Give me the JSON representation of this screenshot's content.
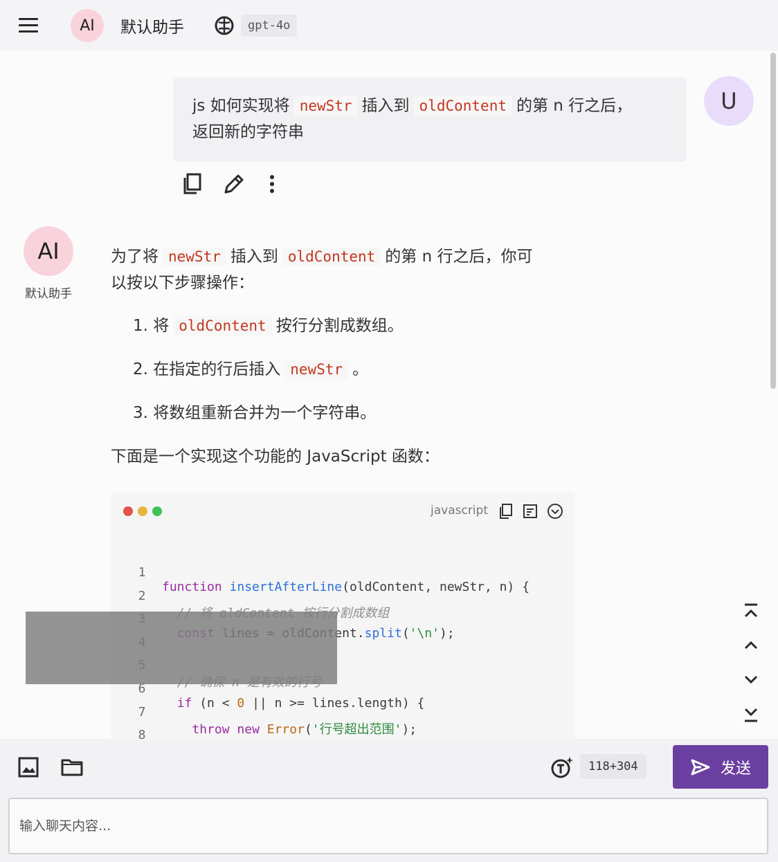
{
  "header": {
    "avatar_text": "AI",
    "assistant_name": "默认助手",
    "model": "gpt-4o"
  },
  "user_message": {
    "avatar": "U",
    "text_1": "js 如何实现将",
    "code_1": "newStr",
    "text_2": "插入到",
    "code_2": "oldContent",
    "text_3": "的第 n 行之后，",
    "text_4": "返回新的字符串",
    "actions": [
      "copy-icon",
      "edit-icon",
      "more-vert-icon"
    ]
  },
  "assistant": {
    "avatar": "AI",
    "name": "默认助手",
    "intro_1": "为了将",
    "intro_code_1": "newStr",
    "intro_2": "插入到",
    "intro_code_2": "oldContent",
    "intro_3": "的第 n 行之后，你可",
    "intro_4": "以按以下步骤操作：",
    "steps": [
      {
        "pre": "1. 将",
        "code": "oldContent",
        "post": "按行分割成数组。"
      },
      {
        "pre": "2. 在指定的行后插入",
        "code": "newStr",
        "post": "。"
      },
      {
        "pre": "3. 将数组重新合并为一个字符串。",
        "code": "",
        "post": ""
      }
    ],
    "outro": "下面是一个实现这个功能的 JavaScript 函数："
  },
  "code_block": {
    "language": "javascript",
    "dot_colors": [
      "#e5534b",
      "#e6b73d",
      "#3cc25a"
    ],
    "tools": [
      "copy-icon",
      "wrap-icon",
      "collapse-icon"
    ],
    "line_numbers": [
      "1",
      "2",
      "3",
      "4",
      "5",
      "6",
      "7",
      "8"
    ]
  },
  "nav_buttons": [
    "scroll-top-icon",
    "scroll-up-icon",
    "scroll-down-icon",
    "scroll-bottom-icon"
  ],
  "footer": {
    "tools": [
      "image-icon",
      "folder-icon"
    ],
    "token_count": "118+304",
    "send_label": "发送",
    "input_placeholder": "输入聊天内容..."
  },
  "colors": {
    "accent": "#6b3fa0",
    "inline_code": "#c4351f",
    "ai_avatar_bg": "#f9d3dc",
    "user_avatar_bg": "#e9dcfb"
  }
}
